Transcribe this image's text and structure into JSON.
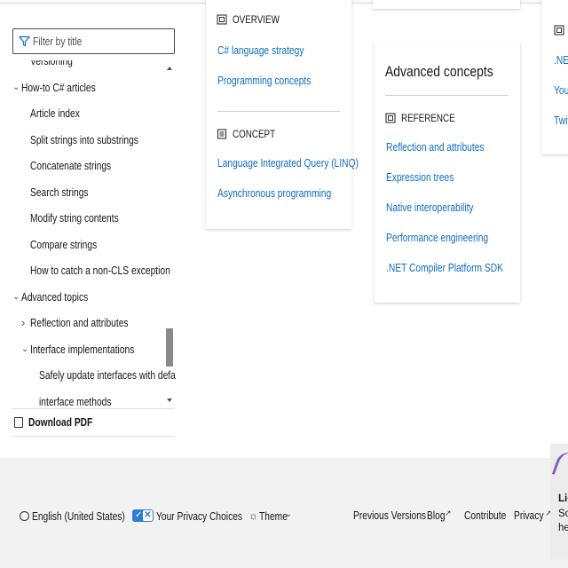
{
  "filter": {
    "placeholder": "Filter by title"
  },
  "nav": {
    "items": [
      {
        "label": "Versioning",
        "level": 1,
        "chevron": ""
      },
      {
        "label": "How-to C# articles",
        "level": 0,
        "chevron": "expanded"
      },
      {
        "label": "Article index",
        "level": 1,
        "chevron": ""
      },
      {
        "label": "Split strings into substrings",
        "level": 1,
        "chevron": ""
      },
      {
        "label": "Concatenate strings",
        "level": 1,
        "chevron": ""
      },
      {
        "label": "Search strings",
        "level": 1,
        "chevron": ""
      },
      {
        "label": "Modify string contents",
        "level": 1,
        "chevron": ""
      },
      {
        "label": "Compare strings",
        "level": 1,
        "chevron": ""
      },
      {
        "label": "How to catch a non-CLS exception",
        "level": 1,
        "chevron": ""
      },
      {
        "label": "Advanced topics",
        "level": 0,
        "chevron": "expanded"
      },
      {
        "label": "Reflection and attributes",
        "level": 1,
        "chevron": "collapsed"
      },
      {
        "label": "Interface implementations",
        "level": 1,
        "chevron": "expanded"
      },
      {
        "label": "Safely update interfaces with default",
        "level": 2,
        "chevron": ""
      },
      {
        "label": "interface methods",
        "level": 2,
        "chevron": ""
      }
    ],
    "download_label": "Download PDF"
  },
  "card_left": {
    "overview_label": "OVERVIEW",
    "overview_links": [
      "C# language strategy",
      "Programming concepts"
    ],
    "concept_label": "CONCEPT",
    "concept_links": [
      "Language Integrated Query (LINQ)",
      "Asynchronous programming"
    ]
  },
  "card_advanced": {
    "title": "Advanced concepts",
    "reference_label": "REFERENCE",
    "links": [
      "Reflection and attributes",
      "Expression trees",
      "Native interoperability",
      "Performance engineering",
      ".NET Compiler Platform SDK"
    ]
  },
  "card_right": {
    "links": [
      ".NET",
      "YouT",
      "Twit"
    ]
  },
  "footer": {
    "language": "English (United States)",
    "privacy": "Your Privacy Choices",
    "theme": "Theme",
    "previous_versions": "Previous Versions",
    "blog": "Blog",
    "contribute": "Contribute",
    "privacy_link": "Privacy",
    "promo_lines": [
      "Lig",
      "Sc",
      "he"
    ]
  },
  "colors": {
    "link": "#0f6cbd",
    "footer_bg": "#f2f2f2",
    "toggle": "#2f7bd6"
  }
}
